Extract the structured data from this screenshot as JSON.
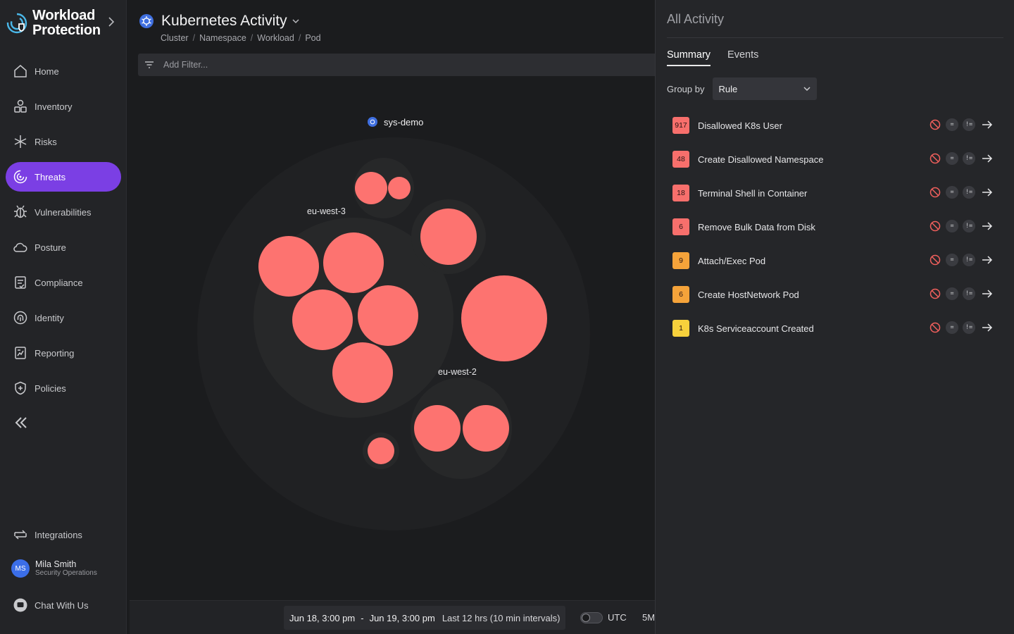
{
  "app": {
    "brand_line1": "Workload",
    "brand_line2": "Protection"
  },
  "sidebar": {
    "items": [
      {
        "label": "Home",
        "icon": "home-icon"
      },
      {
        "label": "Inventory",
        "icon": "inventory-icon"
      },
      {
        "label": "Risks",
        "icon": "risks-icon"
      },
      {
        "label": "Threats",
        "icon": "threats-icon",
        "active": true
      },
      {
        "label": "Vulnerabilities",
        "icon": "bug-icon"
      },
      {
        "label": "Posture",
        "icon": "cloud-icon"
      },
      {
        "label": "Compliance",
        "icon": "compliance-icon"
      },
      {
        "label": "Identity",
        "icon": "fingerprint-icon"
      },
      {
        "label": "Reporting",
        "icon": "report-icon"
      },
      {
        "label": "Policies",
        "icon": "shield-icon"
      }
    ],
    "integrations_label": "Integrations",
    "user": {
      "initials": "MS",
      "name": "Mila Smith",
      "role": "Security Operations"
    },
    "chat_label": "Chat With Us",
    "accent_color": "#7b3fe4"
  },
  "main": {
    "title": "Kubernetes Activity",
    "breadcrumbs": [
      "Cluster",
      "Namespace",
      "Workload",
      "Pod"
    ],
    "filter_placeholder": "Add Filter...",
    "cluster_label": "sys-demo",
    "zone_labels": [
      "eu-west-3",
      "eu-west-2"
    ],
    "bubble_color": "#fd7370",
    "time_range": {
      "start": "Jun 18, 3:00 pm",
      "separator": "-",
      "end": "Jun 19, 3:00 pm",
      "interval": "Last 12 hrs (10 min intervals)"
    },
    "utc_label": "UTC",
    "utc_enabled": false,
    "zoom_label": "5M"
  },
  "panel": {
    "title": "All Activity",
    "tabs": [
      {
        "label": "Summary",
        "active": true
      },
      {
        "label": "Events",
        "active": false
      }
    ],
    "group_by_label": "Group by",
    "group_by_value": "Rule",
    "rules": [
      {
        "count": "917",
        "name": "Disallowed K8s User",
        "color": "#f76f6c"
      },
      {
        "count": "48",
        "name": "Create Disallowed Namespace",
        "color": "#f76f6c"
      },
      {
        "count": "18",
        "name": "Terminal Shell in Container",
        "color": "#f76f6c"
      },
      {
        "count": "6",
        "name": "Remove Bulk Data from Disk",
        "color": "#f76f6c"
      },
      {
        "count": "9",
        "name": "Attach/Exec Pod",
        "color": "#f5a33a"
      },
      {
        "count": "6",
        "name": "Create HostNetwork Pod",
        "color": "#f5a33a"
      },
      {
        "count": "1",
        "name": "K8s Serviceaccount Created",
        "color": "#f7d13c"
      }
    ],
    "action_equal_label": "=",
    "action_not_equal_label": "!="
  }
}
